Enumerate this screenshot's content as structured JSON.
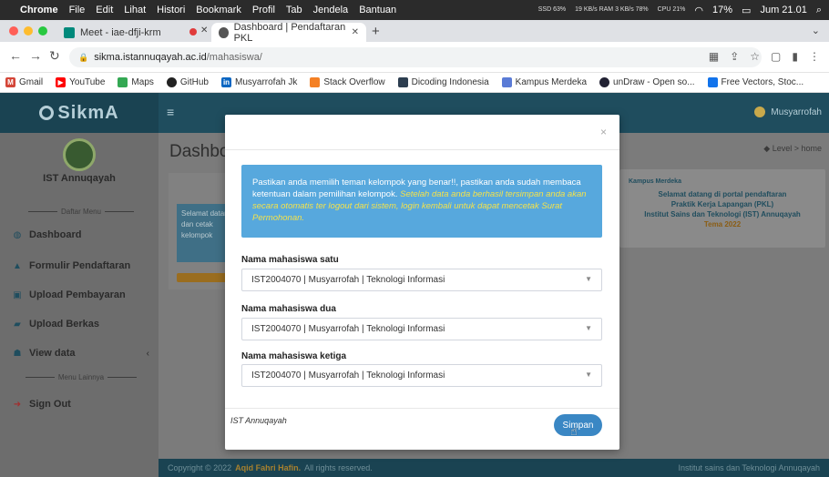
{
  "menubar": {
    "app": "Chrome",
    "items": [
      "File",
      "Edit",
      "Lihat",
      "Histori",
      "Bookmark",
      "Profil",
      "Tab",
      "Jendela",
      "Bantuan"
    ],
    "stats": [
      "SSD 63%",
      "19 KB/s RAM 3 KB/s 78%",
      "CPU 21%"
    ],
    "battery": "17%",
    "clock": "Jum 21.01"
  },
  "tabs": {
    "inactive_title": "Meet - iae-dfji-krm",
    "active_title": "Dashboard | Pendaftaran PKL"
  },
  "address": {
    "host": "sikma.istannuqayah.ac.id",
    "path": "/mahasiswa/"
  },
  "bookmarks": [
    "Gmail",
    "YouTube",
    "Maps",
    "GitHub",
    "Musyarrofah Jk",
    "Stack Overflow",
    "Dicoding Indonesia",
    "Kampus Merdeka",
    "unDraw - Open so...",
    "Free Vectors, Stoc..."
  ],
  "topbar": {
    "logo": "SikmA",
    "user": "Musyarrofah"
  },
  "sidebar": {
    "institution": "IST Annuqayah",
    "section_main": "Daftar Menu",
    "items": [
      {
        "label": "Dashboard",
        "icon": "dashboard-icon"
      },
      {
        "label": "Formulir Pendaftaran",
        "icon": "user-icon"
      },
      {
        "label": "Upload Pembayaran",
        "icon": "money-icon"
      },
      {
        "label": "Upload Berkas",
        "icon": "file-icon"
      },
      {
        "label": "View data",
        "icon": "users-icon"
      }
    ],
    "section_other": "Menu Lainnya",
    "signout": "Sign Out"
  },
  "content": {
    "title": "Dashboard",
    "breadcrumb_level": "Level",
    "breadcrumb_home": "home",
    "info_text": "Selamat datang dan cetak kelompok",
    "banner_line1": "Selamat datang di portal pendaftaran",
    "banner_line2": "Praktik Kerja Lapangan (PKL)",
    "banner_line3": "Institut Sains dan Teknologi (IST) Annuqayah",
    "banner_tema": "Tema 2022",
    "banner_badge": "Kampus Merdeka"
  },
  "footer": {
    "copyright": "Copyright © 2022",
    "author": "Aqid Fahri Hafin.",
    "rights": "All rights reserved.",
    "right_text": "Institut sains dan Teknologi Annuqayah"
  },
  "modal": {
    "close": "×",
    "alert_normal": "Pastikan anda memilih teman kelompok yang benar!!, pastikan anda sudah membaca ketentuan dalam pemilihan kelompok.",
    "alert_highlight": "Setelah data anda berhasil tersimpan anda akan secara otomatis ter logout dari sistem, login kembali untuk dapat mencetak Surat Permohonan.",
    "fields": [
      {
        "label": "Nama mahasiswa satu",
        "value": "IST2004070 | Musyarrofah | Teknologi Informasi"
      },
      {
        "label": "Nama mahasiswa dua",
        "value": "IST2004070 | Musyarrofah | Teknologi Informasi"
      },
      {
        "label": "Nama mahasiswa ketiga",
        "value": "IST2004070 | Musyarrofah | Teknologi Informasi"
      }
    ],
    "footer_text": "IST Annuqayah",
    "submit": "Simpan"
  }
}
